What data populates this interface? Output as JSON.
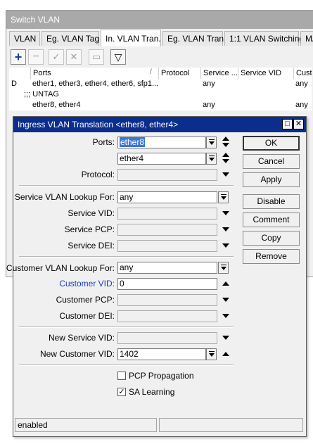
{
  "window": {
    "title": "Switch VLAN",
    "tabs": [
      {
        "label": "VLAN"
      },
      {
        "label": "Eg. VLAN Tag"
      },
      {
        "label": "In. VLAN Tran."
      },
      {
        "label": "Eg. VLAN Tran."
      },
      {
        "label": "1:1 VLAN Switching"
      },
      {
        "label": "MA"
      }
    ],
    "toolbar": {
      "add": "+",
      "remove": "−",
      "enable": "✓",
      "disable": "✕",
      "comment": "▭",
      "filter": "▽"
    },
    "table": {
      "columns": [
        "",
        "Ports",
        "Protocol",
        "Service ...",
        "Service VID",
        "Custo"
      ],
      "sort_marker": "/",
      "rows": [
        {
          "flag": "D",
          "ports": "ether1, ether3, ether4, ether6, sfp1...",
          "protocol": "",
          "service": "any",
          "service_vid": "",
          "customer": "any"
        },
        {
          "flag": ";;; UNTAG",
          "ports": "",
          "protocol": "",
          "service": "",
          "service_vid": "",
          "customer": ""
        },
        {
          "flag": "",
          "ports": "ether8, ether4",
          "protocol": "",
          "service": "any",
          "service_vid": "",
          "customer": "any"
        }
      ]
    }
  },
  "dialog": {
    "title": "Ingress VLAN Translation <ether8, ether4>",
    "labels": {
      "ports": "Ports:",
      "protocol": "Protocol:",
      "service_vlan_lookup": "Service VLAN Lookup For:",
      "service_vid": "Service VID:",
      "service_pcp": "Service PCP:",
      "service_dei": "Service DEI:",
      "customer_vlan_lookup": "Customer VLAN Lookup For:",
      "customer_vid": "Customer VID:",
      "customer_pcp": "Customer PCP:",
      "customer_dei": "Customer DEI:",
      "new_service_vid": "New Service VID:",
      "new_customer_vid": "New Customer VID:"
    },
    "values": {
      "port1": "ether8",
      "port2": "ether4",
      "protocol": "",
      "service_vlan_lookup": "any",
      "service_vid": "",
      "service_pcp": "",
      "service_dei": "",
      "customer_vlan_lookup": "any",
      "customer_vid": "0",
      "customer_pcp": "",
      "customer_dei": "",
      "new_service_vid": "",
      "new_customer_vid": "1402"
    },
    "checkboxes": {
      "pcp_propagation": {
        "label": "PCP Propagation",
        "checked": false,
        "mark": ""
      },
      "sa_learning": {
        "label": "SA Learning",
        "checked": true,
        "mark": "✓"
      }
    },
    "buttons": {
      "ok": "OK",
      "cancel": "Cancel",
      "apply": "Apply",
      "disable": "Disable",
      "comment": "Comment",
      "copy": "Copy",
      "remove": "Remove"
    },
    "window_buttons": {
      "restore": "□",
      "close": "✕"
    },
    "status": {
      "left": "enabled",
      "right": ""
    },
    "colors": {
      "title_bar": "#0b2d8c",
      "selection": "#3a78d7",
      "highlight_label": "#1b3cc7"
    }
  }
}
